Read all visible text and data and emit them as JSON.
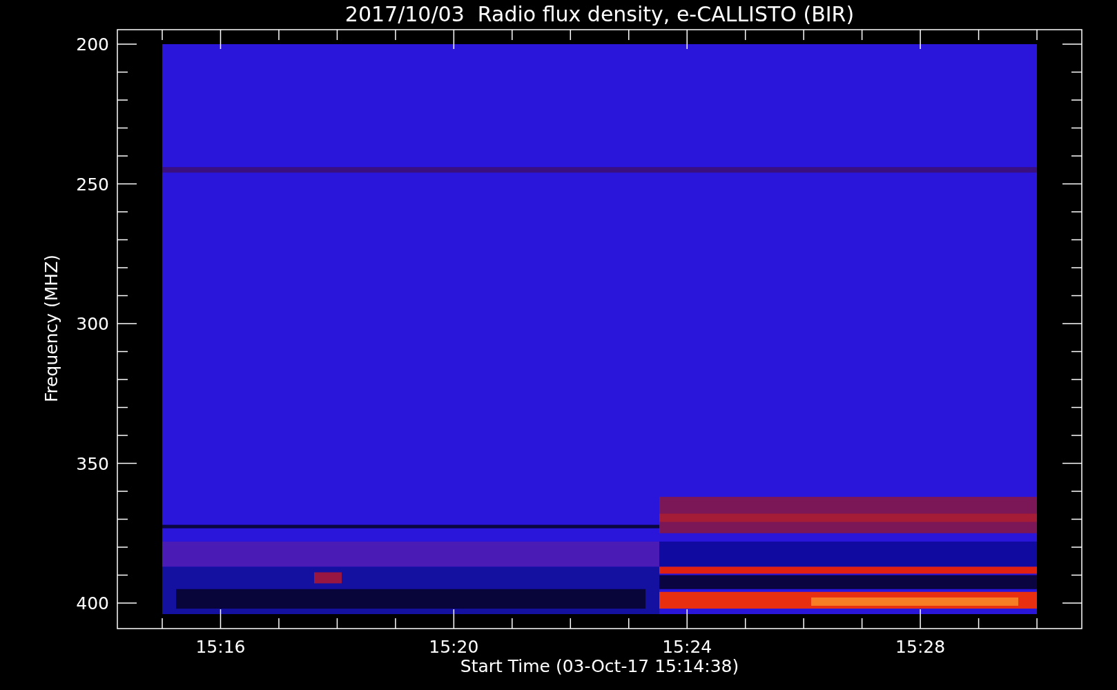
{
  "title": "2017/10/03  Radio flux density, e-CALLISTO (BIR)",
  "y_axis": {
    "label": "Frequency (MHZ)",
    "tick_labels": [
      "200",
      "250",
      "300",
      "350",
      "400"
    ]
  },
  "x_axis": {
    "label": "Start Time (03-Oct-17 15:14:38)",
    "tick_labels": [
      "15:16",
      "15:20",
      "15:24",
      "15:28"
    ]
  }
}
